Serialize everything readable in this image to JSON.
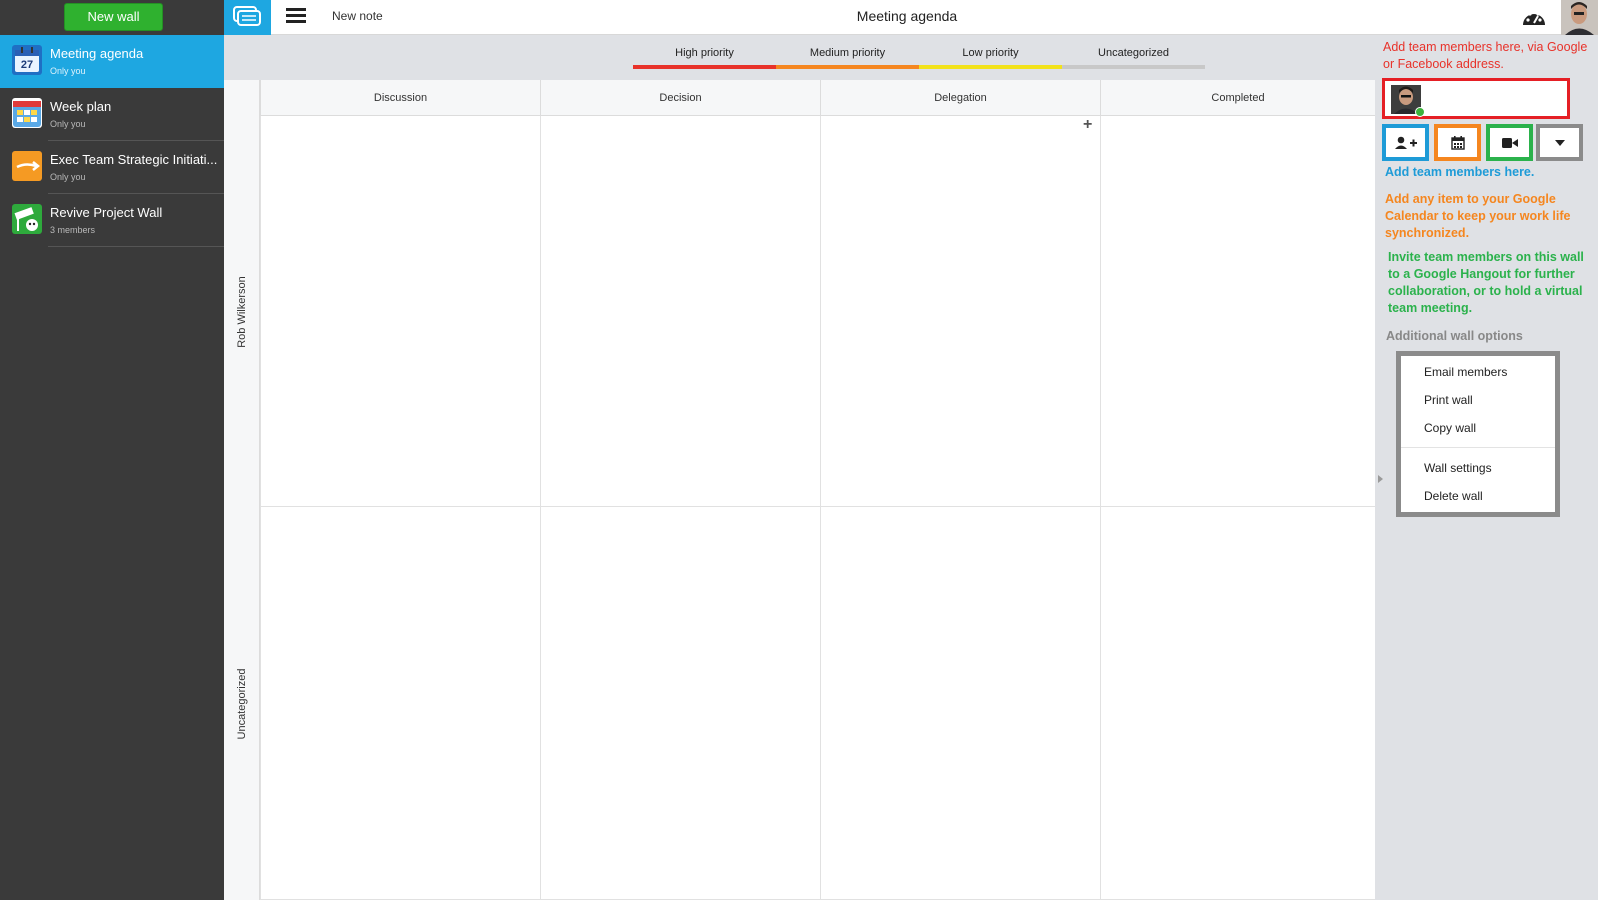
{
  "sidebar": {
    "new_wall_label": "New wall",
    "walls": [
      {
        "title": "Meeting agenda",
        "subtitle": "Only you",
        "icon": "calendar-27-icon",
        "active": true
      },
      {
        "title": "Week plan",
        "subtitle": "Only you",
        "icon": "calendar-grid-icon",
        "active": false
      },
      {
        "title": "Exec Team Strategic Initiati...",
        "subtitle": "Only you",
        "icon": "arrow-icon",
        "active": false
      },
      {
        "title": "Revive Project Wall",
        "subtitle": "3 members",
        "icon": "revive-sign-icon",
        "active": false
      }
    ],
    "calendar_day": "27"
  },
  "topbar": {
    "new_note_label": "New note",
    "wall_title": "Meeting agenda"
  },
  "priorities": [
    {
      "label": "High priority",
      "color": "#e8322a"
    },
    {
      "label": "Medium priority",
      "color": "#f5861f"
    },
    {
      "label": "Low priority",
      "color": "#f2e21a"
    },
    {
      "label": "Uncategorized",
      "color": "#c8c8c8"
    }
  ],
  "board": {
    "columns": [
      "Discussion",
      "Decision",
      "Delegation",
      "Completed"
    ],
    "rows": [
      "Rob Wilkerson",
      "Uncategorized"
    ],
    "add_note_symbol": "+"
  },
  "right_panel": {
    "anno_members_invite": "Add team members here, via Google or Facebook address.",
    "anno_add_members": "Add team members here.",
    "anno_calendar": "Add any item to your Google Calendar to keep your work life synchronized.",
    "anno_hangout": "Invite team members on this wall to a Google Hangout for further collaboration, or to hold a virtual team meeting.",
    "anno_additional": "Additional wall options",
    "toolbar_colors": {
      "add_member": "#1e9bd7",
      "calendar": "#f5861f",
      "hangout": "#2bb24c",
      "more": "#8b8b8b"
    },
    "menu": {
      "email_members": "Email members",
      "print_wall": "Print wall",
      "copy_wall": "Copy wall",
      "wall_settings": "Wall settings",
      "delete_wall": "Delete wall"
    }
  },
  "colors": {
    "sidebar_bg": "#3a3a3a",
    "accent_blue": "#1ea7e1",
    "new_wall_green": "#2fb12f",
    "annotation_red": "#e51f25"
  }
}
